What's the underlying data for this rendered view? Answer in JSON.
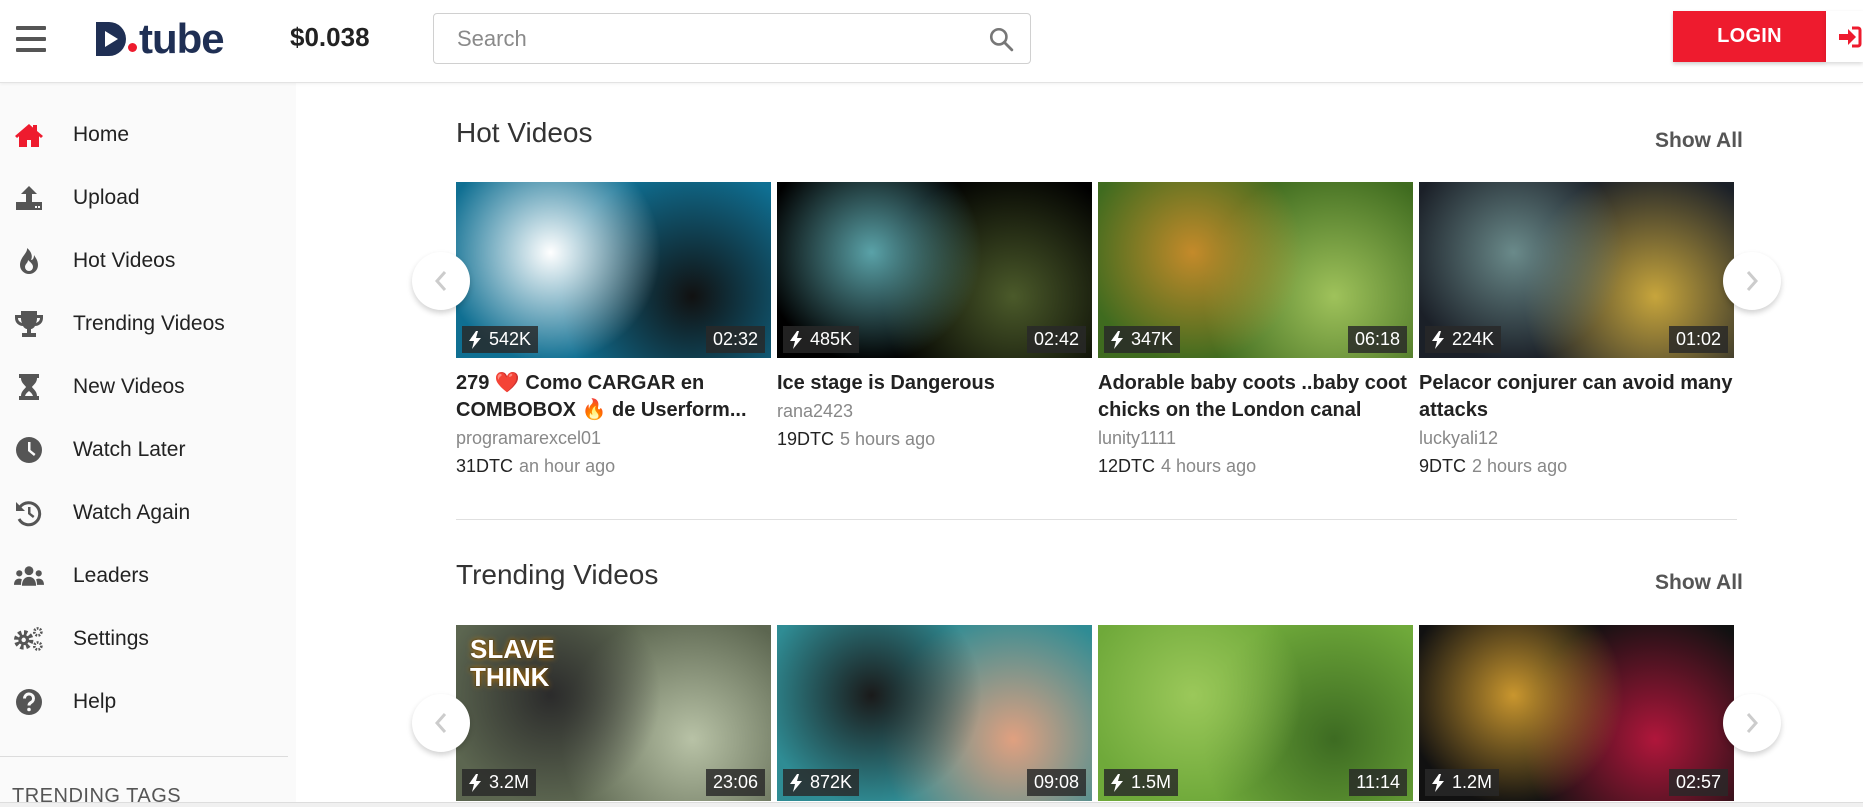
{
  "header": {
    "price": "$0.038",
    "logo_text": "tube",
    "search_placeholder": "Search",
    "search_value": "",
    "login_label": "LOGIN",
    "brand_color": "#ee1b2e",
    "logo_color": "#1f2f54"
  },
  "sidebar": {
    "items": [
      {
        "label": "Home",
        "icon": "home-icon",
        "active": true
      },
      {
        "label": "Upload",
        "icon": "upload-icon"
      },
      {
        "label": "Hot Videos",
        "icon": "fire-icon"
      },
      {
        "label": "Trending Videos",
        "icon": "trophy-icon"
      },
      {
        "label": "New Videos",
        "icon": "hourglass-icon"
      },
      {
        "label": "Watch Later",
        "icon": "clock-icon"
      },
      {
        "label": "Watch Again",
        "icon": "history-icon"
      },
      {
        "label": "Leaders",
        "icon": "users-icon"
      },
      {
        "label": "Settings",
        "icon": "gears-icon"
      },
      {
        "label": "Help",
        "icon": "question-icon"
      }
    ],
    "trending_tags_label": "TRENDING TAGS"
  },
  "sections": [
    {
      "title": "Hot Videos",
      "show_all": "Show All",
      "videos": [
        {
          "views": "542K",
          "duration": "02:32",
          "title": "279 ❤️ Como CARGAR en COMBOBOX 🔥 de Userform...",
          "author": "programarexcel01",
          "dtc": "31DTC",
          "ago": "an hour ago",
          "thumb_colors": [
            "#0f6f92",
            "#ffffff",
            "#111111"
          ]
        },
        {
          "views": "485K",
          "duration": "02:42",
          "title": "Ice stage is Dangerous",
          "author": "rana2423",
          "dtc": "19DTC",
          "ago": "5 hours ago",
          "thumb_colors": [
            "#000000",
            "#5aa2a8",
            "#4b5a2a"
          ]
        },
        {
          "views": "347K",
          "duration": "06:18",
          "title": "Adorable baby coots ..baby coot chicks on the London canal",
          "author": "lunity1111",
          "dtc": "12DTC",
          "ago": "4 hours ago",
          "thumb_colors": [
            "#3f6b1f",
            "#c48a2a",
            "#9fc25b"
          ]
        },
        {
          "views": "224K",
          "duration": "01:02",
          "title": "Pelacor conjurer can avoid many attacks",
          "author": "luckyali12",
          "dtc": "9DTC",
          "ago": "2 hours ago",
          "thumb_colors": [
            "#1b2028",
            "#6a8a8a",
            "#c7a53c"
          ]
        }
      ]
    },
    {
      "title": "Trending Videos",
      "show_all": "Show All",
      "videos": [
        {
          "views": "3.2M",
          "duration": "23:06",
          "thumb_text": "SLAVE THINK",
          "thumb_colors": [
            "#5c6650",
            "#2b2b2b",
            "#b8c2a6"
          ]
        },
        {
          "views": "872K",
          "duration": "09:08",
          "thumb_colors": [
            "#2f8c94",
            "#1a1a1a",
            "#e0a080"
          ]
        },
        {
          "views": "1.5M",
          "duration": "11:14",
          "thumb_colors": [
            "#6fa93a",
            "#9bc85a",
            "#3d6b22"
          ]
        },
        {
          "views": "1.2M",
          "duration": "02:57",
          "thumb_colors": [
            "#111111",
            "#c9962e",
            "#b0163b"
          ]
        }
      ]
    }
  ]
}
